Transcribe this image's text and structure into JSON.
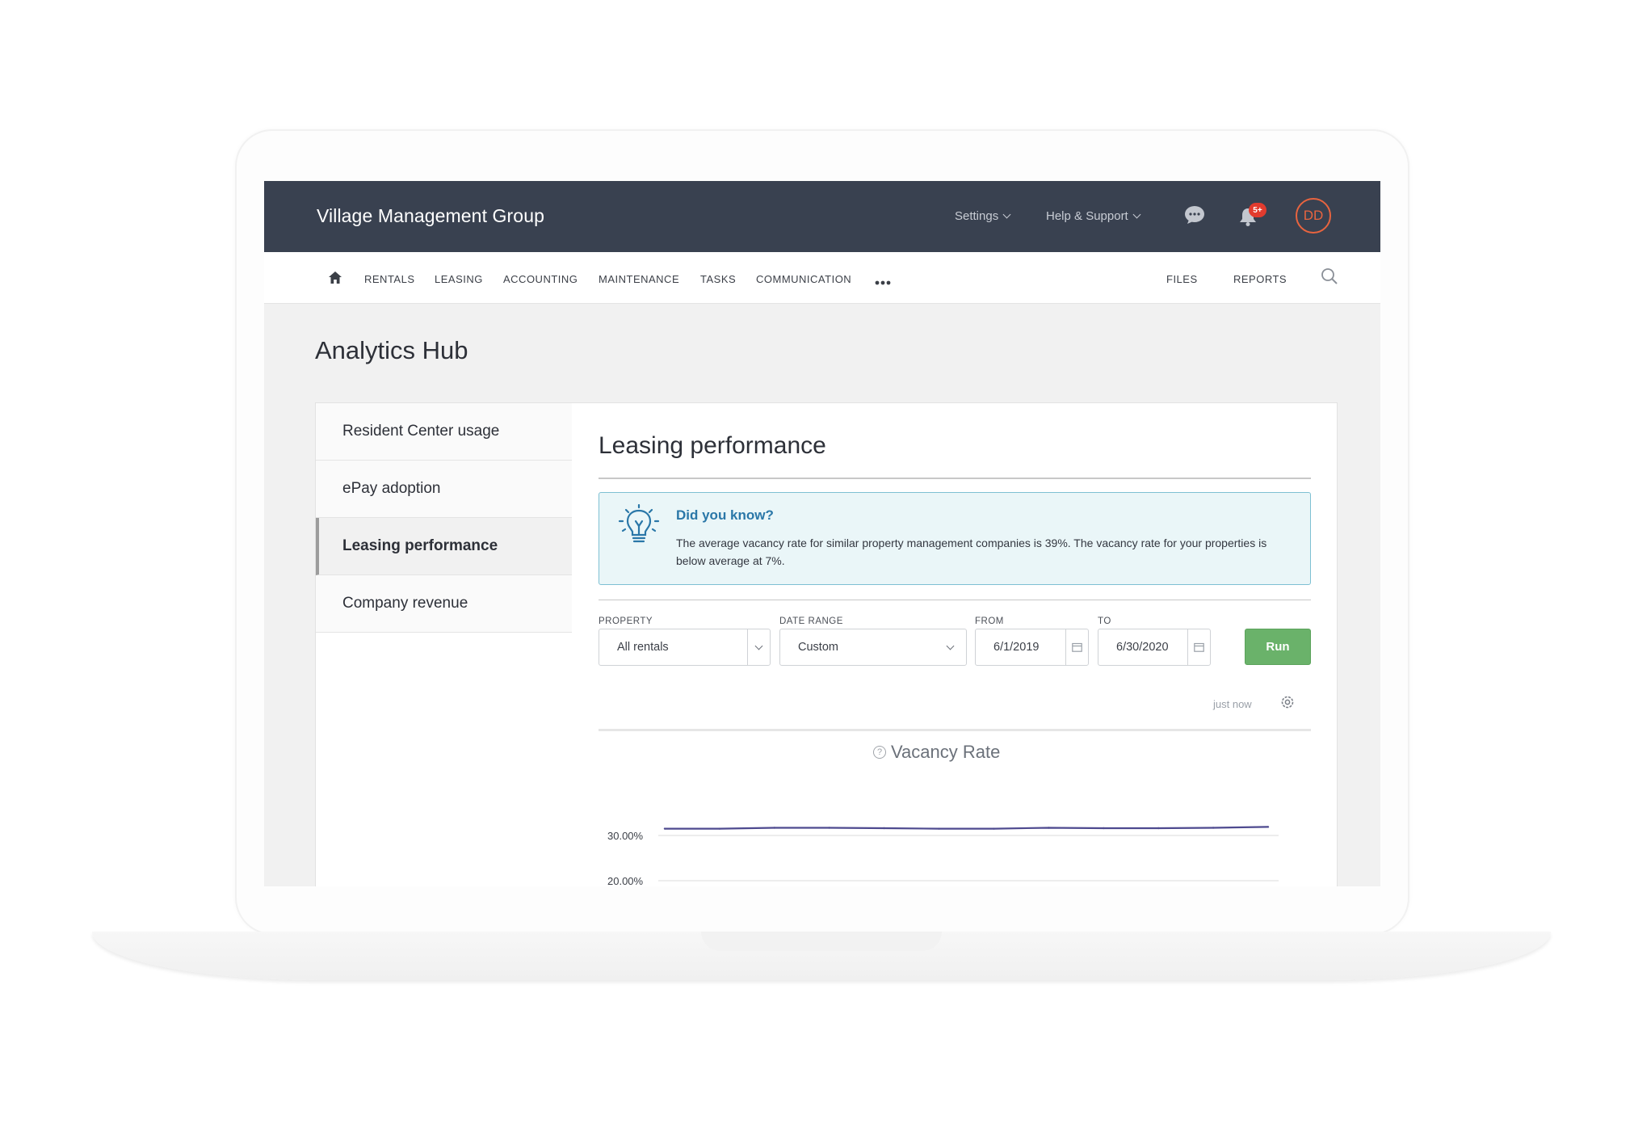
{
  "app": {
    "brand": "Village Management Group",
    "top_menu": [
      {
        "label": "Settings"
      },
      {
        "label": "Help & Support"
      }
    ],
    "notifications_badge": "5+",
    "user_initials": "DD"
  },
  "nav": {
    "items": [
      "RENTALS",
      "LEASING",
      "ACCOUNTING",
      "MAINTENANCE",
      "TASKS",
      "COMMUNICATION"
    ],
    "right_items": [
      "FILES",
      "REPORTS"
    ]
  },
  "page": {
    "title": "Analytics Hub"
  },
  "sidebar": {
    "items": [
      {
        "label": "Resident Center usage"
      },
      {
        "label": "ePay adoption"
      },
      {
        "label": "Leasing performance"
      },
      {
        "label": "Company revenue"
      }
    ],
    "active": "Leasing performance"
  },
  "content": {
    "title": "Leasing performance",
    "info": {
      "title": "Did you know?",
      "text": "The average vacancy rate for similar property management companies is 39%. The vacancy rate for your properties is below average at 7%."
    },
    "filters": {
      "property_label": "PROPERTY",
      "property_value": "All rentals",
      "date_range_label": "DATE RANGE",
      "date_range_value": "Custom",
      "from_label": "FROM",
      "from_value": "6/1/2019",
      "to_label": "TO",
      "to_value": "6/30/2020",
      "run_label": "Run"
    },
    "updated": "just now"
  },
  "colors": {
    "topbar": "#394150",
    "accent_orange": "#e8643f",
    "badge_red": "#e23b2e",
    "info_blue": "#2a77a8",
    "run_green": "#6ab26a",
    "line_purple": "#4e4a8f"
  },
  "chart_data": {
    "type": "line",
    "title": "Vacancy Rate",
    "y_ticks": [
      "30.00%",
      "20.00%"
    ],
    "grid": true,
    "series": [
      {
        "values": [
          31.5,
          31.5,
          31.7,
          31.7,
          31.6,
          31.5,
          31.5,
          31.7,
          31.6,
          31.6,
          31.7,
          31.9
        ]
      }
    ],
    "ylim": [
      20,
      32
    ]
  }
}
